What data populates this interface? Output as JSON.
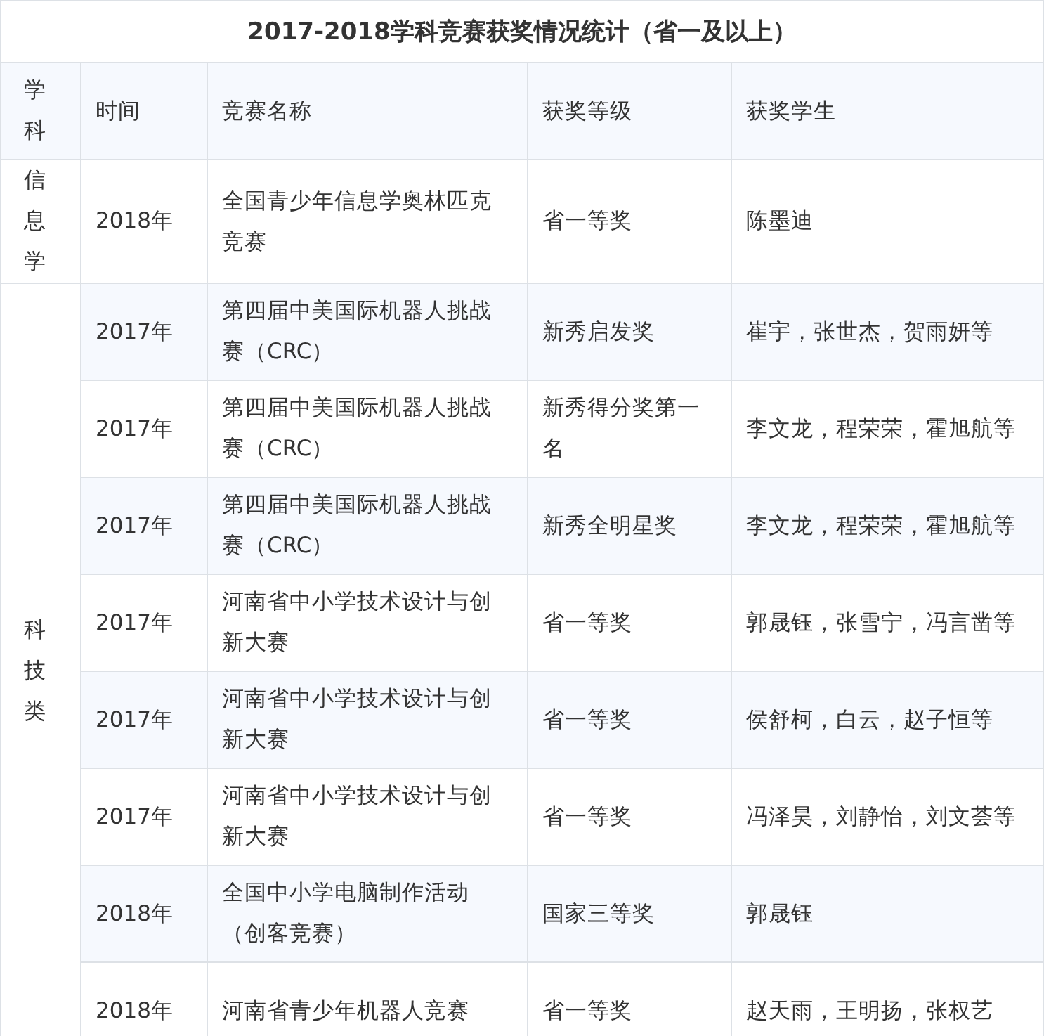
{
  "title": "2017-2018学科竞赛获奖情况统计（省一及以上）",
  "columns": [
    "学科",
    "时间",
    "竞赛名称",
    "获奖等级",
    "获奖学生"
  ],
  "groups": [
    {
      "subject": "信息学",
      "rows": [
        {
          "year": "2018年",
          "contest": "全国青少年信息学奥林匹克竞赛",
          "award": "省一等奖",
          "students": "陈墨迪"
        }
      ]
    },
    {
      "subject": "科技类",
      "rows": [
        {
          "year": "2017年",
          "contest": "第四届中美国际机器人挑战赛（CRC）",
          "award": "新秀启发奖",
          "students": "崔宇，张世杰，贺雨妍等"
        },
        {
          "year": "2017年",
          "contest": "第四届中美国际机器人挑战赛（CRC）",
          "award": "新秀得分奖第一名",
          "students": "李文龙，程荣荣，霍旭航等"
        },
        {
          "year": "2017年",
          "contest": "第四届中美国际机器人挑战赛（CRC）",
          "award": "新秀全明星奖",
          "students": "李文龙，程荣荣，霍旭航等"
        },
        {
          "year": "2017年",
          "contest": "河南省中小学技术设计与创新大赛",
          "award": "省一等奖",
          "students": "郭晟钰，张雪宁，冯言凿等"
        },
        {
          "year": "2017年",
          "contest": "河南省中小学技术设计与创新大赛",
          "award": "省一等奖",
          "students": "侯舒柯，白云，赵子恒等"
        },
        {
          "year": "2017年",
          "contest": "河南省中小学技术设计与创新大赛",
          "award": "省一等奖",
          "students": "冯泽昊，刘静怡，刘文荟等"
        },
        {
          "year": "2018年",
          "contest": "全国中小学电脑制作活动（创客竞赛）",
          "award": "国家三等奖",
          "students": "郭晟钰"
        },
        {
          "year": "2018年",
          "contest": "河南省青少年机器人竞赛",
          "award": "省一等奖",
          "students": "赵天雨，王明扬，张权艺"
        }
      ]
    }
  ]
}
